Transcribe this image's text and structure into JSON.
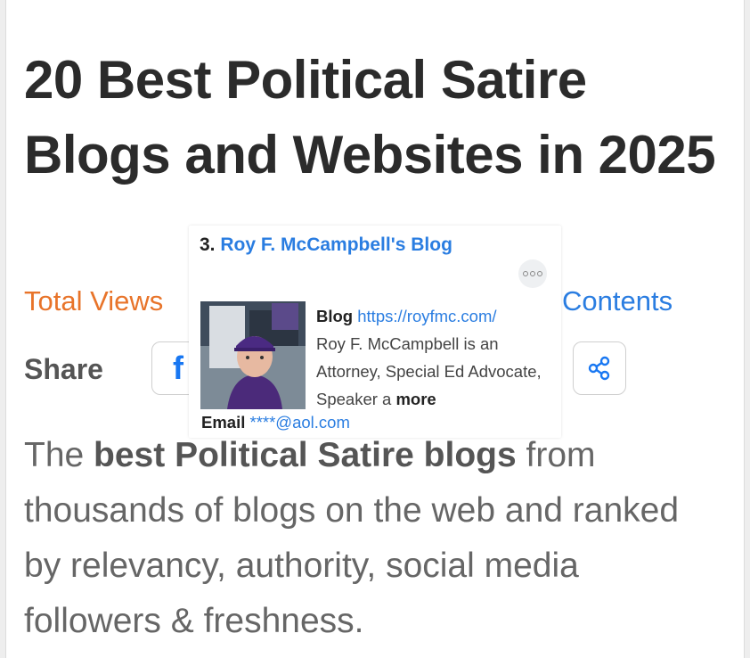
{
  "article": {
    "title": "20 Best Political Satire Blogs and Websites in 2025",
    "total_views_label": "Total Views",
    "contents_label": "Contents",
    "share_label": "Share",
    "intro_prefix": "The ",
    "intro_bold": "best Political Satire blogs",
    "intro_suffix": " from thousands of blogs on the web and ranked by relevancy, authority, social media followers & freshness."
  },
  "share_buttons": [
    {
      "icon": "facebook-icon",
      "glyph": "f"
    },
    {
      "icon": "share-icon"
    }
  ],
  "popup": {
    "rank": "3.",
    "name": "Roy F. McCampbell's Blog",
    "blog_label": "Blog",
    "blog_url": "https://royfmc.com/",
    "description": "Roy F. McCampbell is an Attorney, Special Ed Advocate, Speaker a",
    "more_label": "more",
    "email_label": "Email",
    "email_value": "****@aol.com",
    "menu_icon": "more-options-icon"
  },
  "colors": {
    "title": "#2b2b2b",
    "views": "#e8742a",
    "link": "#2a7de1",
    "body_text": "#666666",
    "facebook": "#1877f2"
  }
}
